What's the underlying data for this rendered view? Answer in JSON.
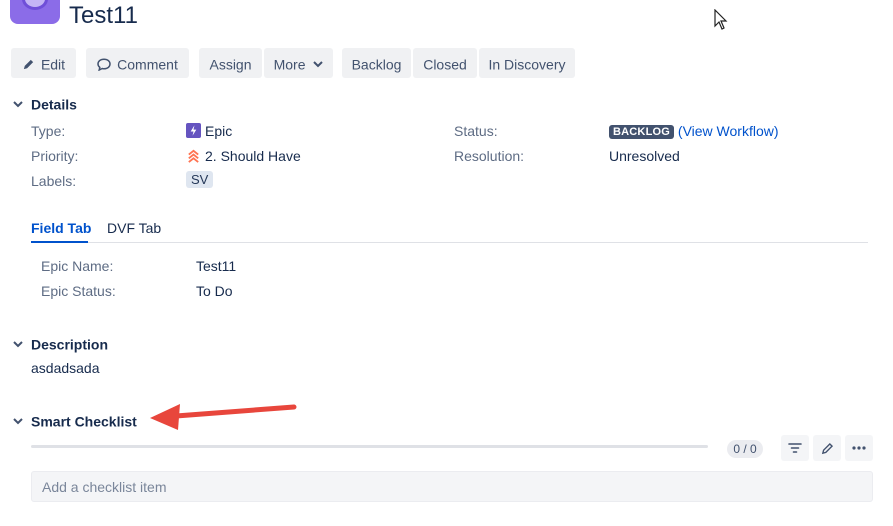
{
  "issue": {
    "title": "Test11"
  },
  "toolbar": {
    "edit": "Edit",
    "comment": "Comment",
    "assign": "Assign",
    "more": "More",
    "backlog": "Backlog",
    "closed": "Closed",
    "in_discovery": "In Discovery"
  },
  "details": {
    "heading": "Details",
    "type_label": "Type:",
    "type_value": "Epic",
    "priority_label": "Priority:",
    "priority_value": "2. Should Have",
    "labels_label": "Labels:",
    "labels_value": "SV",
    "status_label": "Status:",
    "status_value": "BACKLOG",
    "status_link": "(View Workflow)",
    "resolution_label": "Resolution:",
    "resolution_value": "Unresolved"
  },
  "tabs": {
    "field_tab": "Field Tab",
    "dvf_tab": "DVF Tab"
  },
  "epic": {
    "name_label": "Epic Name:",
    "name_value": "Test11",
    "status_label": "Epic Status:",
    "status_value": "To Do"
  },
  "description": {
    "heading": "Description",
    "text": "asdadsada"
  },
  "checklist": {
    "heading": "Smart Checklist",
    "count": "0 / 0",
    "progress": 0,
    "placeholder": "Add a checklist item"
  },
  "colors": {
    "accent": "#0052cc",
    "status_badge": "#42526e",
    "epic_icon": "#6554c0",
    "priority_icon": "#ff7452",
    "annotation_arrow": "#e8463c"
  },
  "icons": [
    "pencil-icon",
    "comment-icon",
    "chevron-down-icon",
    "epic-icon",
    "priority-high-icon",
    "filter-icon",
    "edit-icon",
    "more-icon",
    "cursor-icon",
    "annotation-arrow"
  ]
}
